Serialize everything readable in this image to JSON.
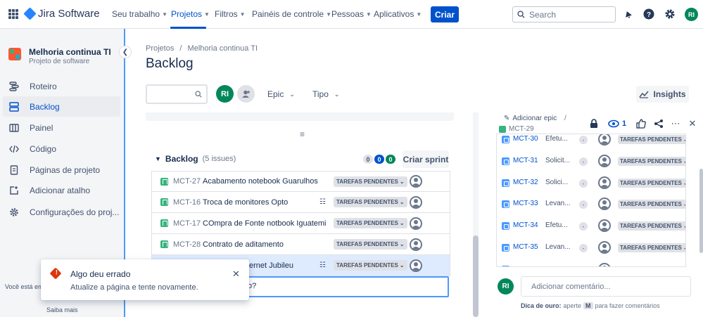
{
  "topnav": {
    "logo_text": "Jira Software",
    "items": [
      {
        "label": "Seu trabalho"
      },
      {
        "label": "Projetos"
      },
      {
        "label": "Filtros"
      },
      {
        "label": "Painéis de controle"
      },
      {
        "label": "Pessoas"
      },
      {
        "label": "Aplicativos"
      }
    ],
    "create_label": "Criar",
    "search_placeholder": "Search",
    "avatar_initials": "RI"
  },
  "sidebar": {
    "project_name": "Melhoria continua TI",
    "project_type": "Projeto de software",
    "items": [
      {
        "label": "Roteiro",
        "icon": "roadmap-icon"
      },
      {
        "label": "Backlog",
        "icon": "backlog-icon",
        "active": true
      },
      {
        "label": "Painel",
        "icon": "board-icon"
      },
      {
        "label": "Código",
        "icon": "code-icon"
      },
      {
        "label": "Páginas de projeto",
        "icon": "page-icon"
      },
      {
        "label": "Adicionar atalho",
        "icon": "add-shortcut-icon"
      },
      {
        "label": "Configurações do proj...",
        "icon": "settings-icon"
      }
    ],
    "footer_text": "Você está em",
    "learn_more": "Saiba mais"
  },
  "main": {
    "breadcrumb": {
      "root": "Projetos",
      "separator": "/",
      "project": "Melhoria continua TI"
    },
    "title": "Backlog",
    "filters": {
      "avatar_initials": "RI",
      "epic_label": "Epic",
      "type_label": "Tipo"
    },
    "insights_label": "Insights",
    "backlog": {
      "label": "Backlog",
      "issue_count": "(5 issues)",
      "counts": [
        "0",
        "0",
        "0"
      ],
      "create_sprint_label": "Criar sprint"
    },
    "issues": [
      {
        "key": "MCT-27",
        "summary": "Acabamento notebook Guarulhos",
        "status": "TAREFAS PENDENTES",
        "has_children": false
      },
      {
        "key": "MCT-16",
        "summary": "Troca de monitores Opto",
        "status": "TAREFAS PENDENTES",
        "has_children": true
      },
      {
        "key": "MCT-17",
        "summary": "COmpra de Fonte notbook Iguatemi",
        "status": "TAREFAS PENDENTES",
        "has_children": false
      },
      {
        "key": "MCT-28",
        "summary": "Contrato de aditamento",
        "status": "TAREFAS PENDENTES",
        "has_children": false
      },
      {
        "key": "",
        "summary": "ernet Jubileu",
        "status": "TAREFAS PENDENTES",
        "has_children": true,
        "selected": true
      }
    ],
    "create_input_text": "o?"
  },
  "toast": {
    "title": "Algo deu errado",
    "description": "Atualize a página e tente novamente."
  },
  "detail": {
    "add_epic_label": "Adicionar epic",
    "separator": "/",
    "issue_key": "MCT-29",
    "watch_count": "1",
    "children": [
      {
        "key": "MCT-30",
        "summary": "Efetu...",
        "priority": "-",
        "status": "TAREFAS PENDENTES"
      },
      {
        "key": "MCT-31",
        "summary": "Solicit...",
        "priority": "-",
        "status": "TAREFAS PENDENTES"
      },
      {
        "key": "MCT-32",
        "summary": "Solici...",
        "priority": "-",
        "status": "TAREFAS PENDENTES"
      },
      {
        "key": "MCT-33",
        "summary": "Levan...",
        "priority": "-",
        "status": "TAREFAS PENDENTES"
      },
      {
        "key": "MCT-34",
        "summary": "Efetu...",
        "priority": "-",
        "status": "TAREFAS PENDENTES"
      },
      {
        "key": "MCT-35",
        "summary": "Levan...",
        "priority": "-",
        "status": "TAREFAS PENDENTES"
      }
    ],
    "comment_avatar": "RI",
    "comment_placeholder": "Adicionar comentário...",
    "tip": {
      "bold": "Dica de ouro:",
      "before": "aperte",
      "key": "M",
      "after": "para fazer comentários"
    }
  }
}
